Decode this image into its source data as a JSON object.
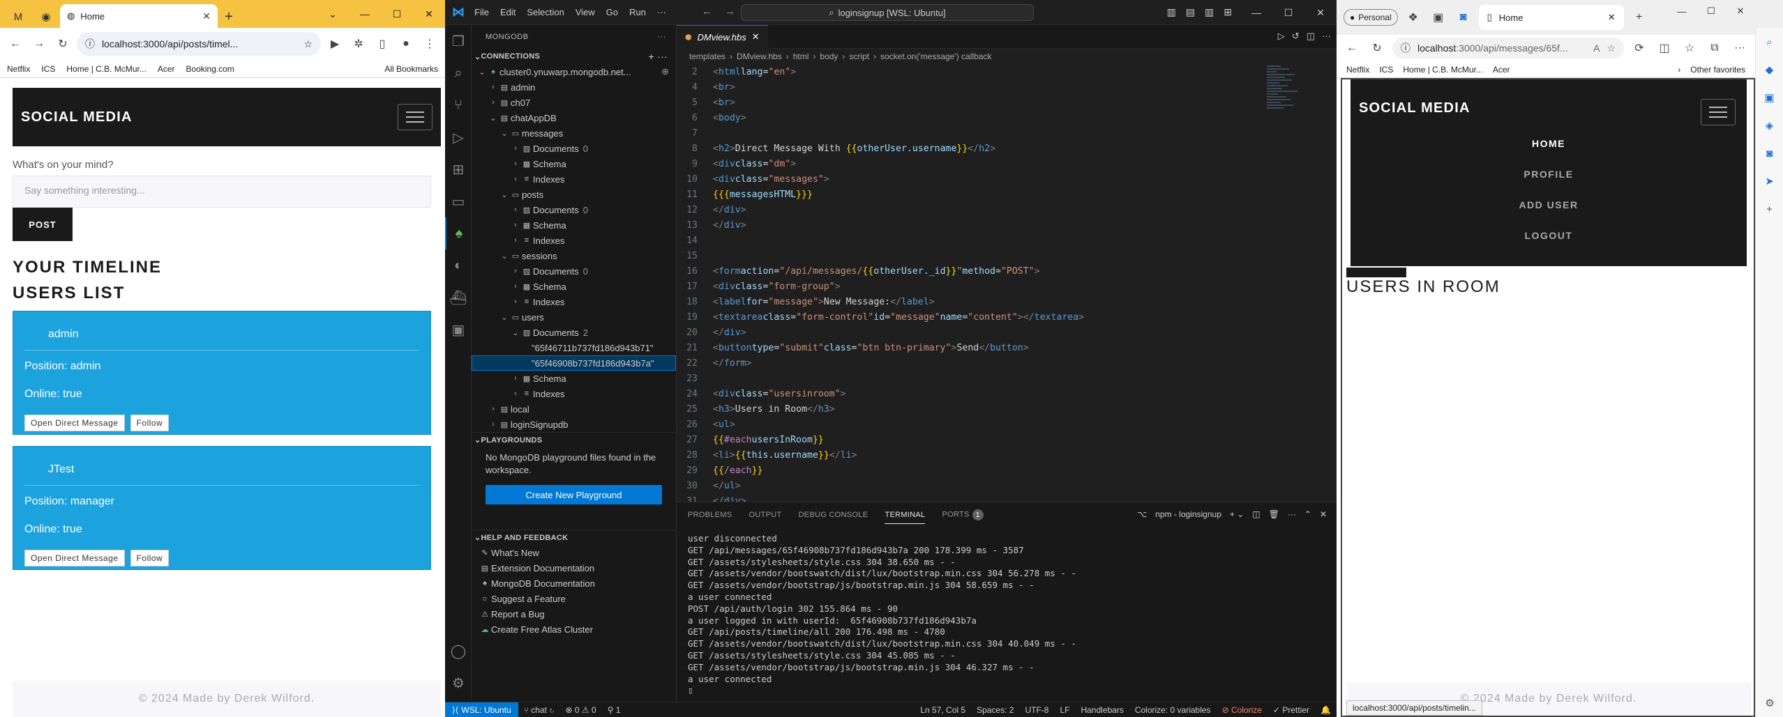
{
  "chrome": {
    "tab_title": "Home",
    "url": "localhost:3000/api/posts/timel...",
    "bookmarks": [
      "Netflix",
      "ICS",
      "Home | C.B. McMur...",
      "Acer",
      "Booking.com",
      "All Bookmarks"
    ],
    "page": {
      "brand": "SOCIAL MEDIA",
      "mind_label": "What's on your mind?",
      "post_placeholder": "Say something interesting...",
      "post_button": "POST",
      "timeline_heading": "YOUR TIMELINE",
      "users_heading": "USERS LIST",
      "users": [
        {
          "name": "admin",
          "position": "Position: admin",
          "online": "Online: true",
          "dm": "Open Direct Message",
          "follow": "Follow"
        },
        {
          "name": "JTest",
          "position": "Position: manager",
          "online": "Online: true",
          "dm": "Open Direct Message",
          "follow": "Follow"
        }
      ],
      "footer": "© 2024 Made by Derek Wilford."
    }
  },
  "vscode": {
    "menu": [
      "File",
      "Edit",
      "Selection",
      "View",
      "Go",
      "Run"
    ],
    "search": "loginsignup [WSL: Ubuntu]",
    "sidebar_title": "MONGODB",
    "connections_label": "CONNECTIONS",
    "tree": {
      "cluster": "cluster0.ynuwarp.mongodb.net...",
      "db_admin": "admin",
      "db_ch07": "ch07",
      "db_chat": "chatAppDB",
      "coll_messages": "messages",
      "coll_posts": "posts",
      "coll_sessions": "sessions",
      "coll_users": "users",
      "documents": "Documents",
      "schema": "Schema",
      "indexes": "Indexes",
      "count_messages": "0",
      "count_posts": "0",
      "count_sessions": "0",
      "count_users": "2",
      "doc1": "\"65f46711b737fd186d943b71\"",
      "doc2": "\"65f46908b737fd186d943b7a\"",
      "db_local": "local",
      "db_login": "loginSignupdb"
    },
    "playgrounds_label": "PLAYGROUNDS",
    "playgrounds_text": "No MongoDB playground files found in the workspace.",
    "create_playground": "Create New Playground",
    "help_label": "HELP AND FEEDBACK",
    "help_items": [
      "What's New",
      "Extension Documentation",
      "MongoDB Documentation",
      "Suggest a Feature",
      "Report a Bug",
      "Create Free Atlas Cluster"
    ],
    "tab_name": "DMview.hbs",
    "breadcrumb": [
      "templates",
      "DMview.hbs",
      "html",
      "body",
      "script",
      "socket.on('message') callback"
    ],
    "panel_tabs": [
      "PROBLEMS",
      "OUTPUT",
      "DEBUG CONSOLE",
      "TERMINAL",
      "PORTS"
    ],
    "ports_count": "1",
    "terminal_name": "npm - loginsignup",
    "terminal_lines": [
      "user disconnected",
      "GET /api/messages/65f46908b737fd186d943b7a 200 178.399 ms - 3587",
      "GET /assets/stylesheets/style.css 304 38.650 ms - -",
      "GET /assets/vendor/bootswatch/dist/lux/bootstrap.min.css 304 56.278 ms - -",
      "GET /assets/vendor/bootstrap/js/bootstrap.min.js 304 58.659 ms - -",
      "a user connected",
      "POST /api/auth/login 302 155.864 ms - 90",
      "a user logged in with userId:  65f46908b737fd186d943b7a",
      "GET /api/posts/timeline/all 200 176.498 ms - 4780",
      "GET /assets/vendor/bootswatch/dist/lux/bootstrap.min.css 304 40.049 ms - -",
      "GET /assets/stylesheets/style.css 304 45.085 ms - -",
      "GET /assets/vendor/bootstrap/js/bootstrap.min.js 304 46.327 ms - -",
      "a user connected"
    ],
    "status": {
      "remote": "WSL: Ubuntu",
      "branch": "chat",
      "problems": "⊗ 0 ⚠ 0",
      "ports": "1",
      "position": "Ln 57, Col 5",
      "spaces": "Spaces: 2",
      "encoding": "UTF-8",
      "eol": "LF",
      "language": "Handlebars",
      "colorize_vars": "Colorize: 0 variables",
      "colorize": "Colorize",
      "prettier": "Prettier"
    }
  },
  "edge": {
    "profile": "Personal",
    "tab_title": "Home",
    "url_host": "localhost",
    "url_rest": ":3000/api/messages/65f...",
    "bookmarks": [
      "Netflix",
      "ICS",
      "Home | C.B. McMur...",
      "Acer",
      "Other favorites"
    ],
    "page": {
      "brand": "SOCIAL MEDIA",
      "links": [
        "HOME",
        "PROFILE",
        "ADD USER",
        "LOGOUT"
      ],
      "heading": "USERS IN ROOM",
      "footer": "© 2024 Made by Derek Wilford.",
      "status_url": "localhost:3000/api/posts/timelin..."
    }
  }
}
